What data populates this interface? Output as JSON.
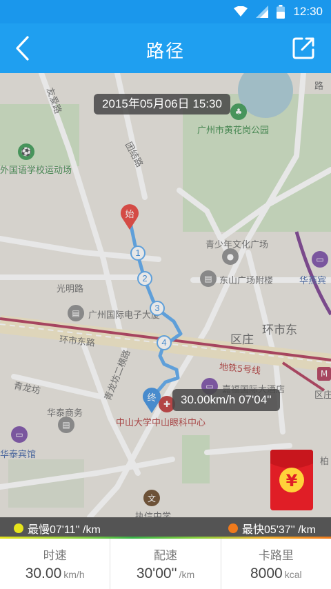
{
  "status_bar": {
    "time": "12:30"
  },
  "header": {
    "title": "路径"
  },
  "map": {
    "date_time": "2015年05月06日  15:30",
    "end_speed_tooltip": "30.00km/h  07'04''",
    "start_marker": "始",
    "end_marker": "终",
    "checkpoints": [
      "1",
      "2",
      "3",
      "4"
    ],
    "labels": {
      "school_field": "外国语学校运动场",
      "park": "广州市黄花岗公园",
      "youth_palace": "青少年文化广场",
      "dongshan": "东山广场附楼",
      "huayan": "华燕宾",
      "guangming": "光明路",
      "electronics": "广州国际电子大厦",
      "huanshi_dong_road": "环市东路",
      "huanshi_dong": "环市东",
      "district": "区庄",
      "metro": "地铁5号线",
      "metro_station": "区庄",
      "hotel": "嘉福国际大酒店",
      "qinglong": "青龙坊",
      "qinglong_2": "青龙坊二横路",
      "huatai_business": "华泰商务",
      "eye_center": "中山大学中山眼科中心",
      "huatai_hotel": "华泰宾馆",
      "tuanjie": "团结路",
      "youai": "友爱路",
      "road_top": "路",
      "zhixin": "执信中学",
      "bai": "柏"
    }
  },
  "pace": {
    "slowest": "最慢07'11'' /km",
    "fastest": "最快05'37'' /km",
    "slow_color": "#e6e41c",
    "fast_color": "#f07a1c"
  },
  "stats": [
    {
      "label": "时速",
      "value": "30.00",
      "unit": "km/h"
    },
    {
      "label": "配速",
      "value": "30'00''",
      "unit": "/km"
    },
    {
      "label": "卡路里",
      "value": "8000",
      "unit": "kcal"
    }
  ],
  "colors": {
    "primary": "#1f9ff0",
    "route": "#5aa8ee",
    "metro": "#b03a5a"
  }
}
